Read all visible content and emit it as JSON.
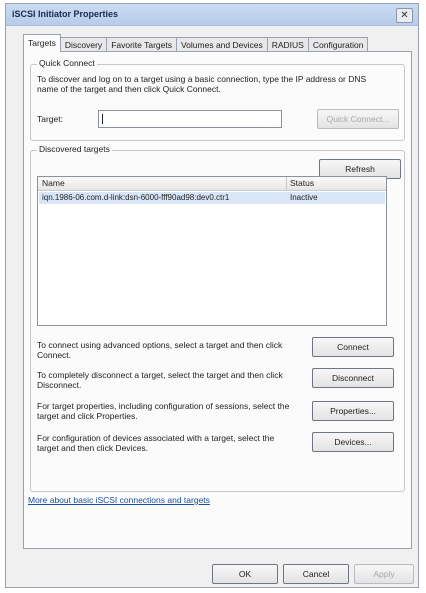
{
  "window": {
    "title": "iSCSI Initiator Properties",
    "close_glyph": "✕"
  },
  "tabs": [
    {
      "label": "Targets",
      "active": true
    },
    {
      "label": "Discovery",
      "active": false
    },
    {
      "label": "Favorite Targets",
      "active": false
    },
    {
      "label": "Volumes and Devices",
      "active": false
    },
    {
      "label": "RADIUS",
      "active": false
    },
    {
      "label": "Configuration",
      "active": false
    }
  ],
  "quick_connect": {
    "legend": "Quick Connect",
    "description": "To discover and log on to a target using a basic connection, type the IP address or DNS name of the target and then click Quick Connect.",
    "target_label": "Target:",
    "target_value": "",
    "button_label": "Quick Connect..."
  },
  "discovered": {
    "legend": "Discovered targets",
    "refresh_label": "Refresh",
    "columns": [
      "Name",
      "Status"
    ],
    "rows": [
      {
        "name": "iqn.1986-06.com.d-link:dsn-6000-fff90ad98:dev0.ctr1",
        "status": "Inactive"
      }
    ],
    "actions": [
      {
        "text": "To connect using advanced options, select a target and then click Connect.",
        "button": "Connect"
      },
      {
        "text": "To completely disconnect a target, select the target and then click Disconnect.",
        "button": "Disconnect"
      },
      {
        "text": "For target properties, including configuration of sessions, select the target and click Properties.",
        "button": "Properties..."
      },
      {
        "text": "For configuration of devices associated with a target, select the target and then click Devices.",
        "button": "Devices..."
      }
    ]
  },
  "help_link": "More about basic iSCSI connections and targets",
  "footer": {
    "ok": "OK",
    "cancel": "Cancel",
    "apply": "Apply"
  }
}
